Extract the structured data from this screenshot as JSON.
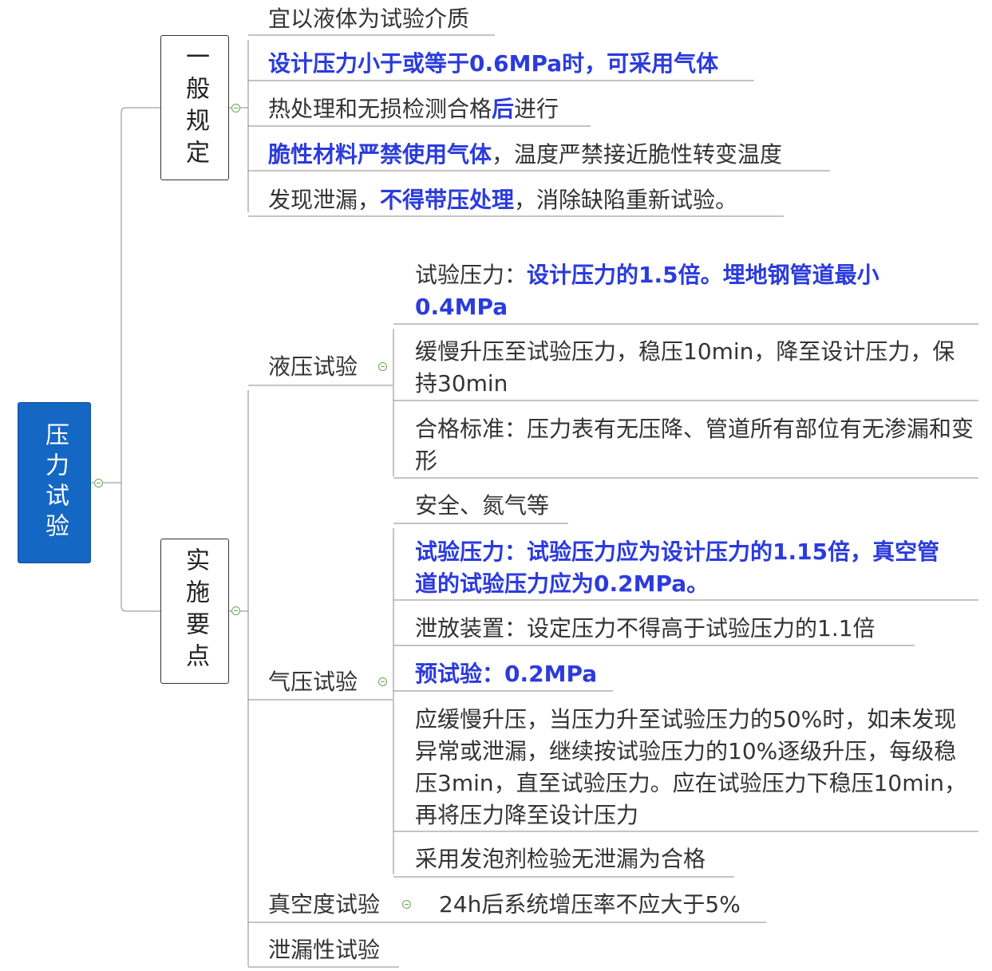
{
  "root": {
    "label": "压力试验"
  },
  "branches": {
    "general": {
      "label": "一般规定",
      "items": [
        [
          {
            "t": "宜以液体为试验介质",
            "b": false
          }
        ],
        [
          {
            "t": "设计压力小于或等于0.6MPa时，可采用气体",
            "b": true
          }
        ],
        [
          {
            "t": "热处理和无损检测合格",
            "b": false
          },
          {
            "t": "后",
            "b": true
          },
          {
            "t": "进行",
            "b": false
          }
        ],
        [
          {
            "t": "脆性材料严禁使用气体",
            "b": true
          },
          {
            "t": "，温度严禁接近脆性转变温度",
            "b": false
          }
        ],
        [
          {
            "t": "发现泄漏，",
            "b": false
          },
          {
            "t": "不得带压处理",
            "b": true
          },
          {
            "t": "，消除缺陷重新试验。",
            "b": false
          }
        ]
      ]
    },
    "key_points": {
      "label": "实施要点",
      "hydro": {
        "label": "液压试验",
        "items": [
          [
            {
              "t": "试验压力：",
              "b": false
            },
            {
              "t": "设计压力的1.5倍。埋地钢管道最小0.4MPa",
              "b": true
            }
          ],
          [
            {
              "t": "缓慢升压至试验压力，稳压10min，降至设计压力，保持30min",
              "b": false
            }
          ],
          [
            {
              "t": "合格标准：压力表有无压降、管道所有部位有无渗漏和变形",
              "b": false
            }
          ]
        ]
      },
      "pneumatic": {
        "label": "气压试验",
        "items": [
          [
            {
              "t": "安全、氮气等",
              "b": false
            }
          ],
          [
            {
              "t": "试验压力：试验压力应为设计压力的1.15倍，真空管道的试验压力应为0.2MPa。",
              "b": true
            }
          ],
          [
            {
              "t": "泄放装置：设定压力不得高于试验压力的1.1倍",
              "b": false
            }
          ],
          [
            {
              "t": "预试验：0.2MPa",
              "b": true
            }
          ],
          [
            {
              "t": "应缓慢升压，当压力升至试验压力的50%时，如未发现异常或泄漏，继续按试验压力的10%逐级升压，每级稳压3min，直至试验压力。应在试验压力下稳压10min，再将压力降至设计压力",
              "b": false
            }
          ],
          [
            {
              "t": "采用发泡剂检验无泄漏为合格",
              "b": false
            }
          ]
        ]
      },
      "vacuum": {
        "label": "真空度试验",
        "items": [
          [
            {
              "t": "24h后系统增压率不应大于5%",
              "b": false
            }
          ]
        ]
      },
      "leak": {
        "label": "泄漏性试验"
      }
    }
  },
  "colors": {
    "root_fill": "#1467c2",
    "emphasis": "#2b3bdd",
    "line": "#888888",
    "collapse": "#6aa84f"
  }
}
